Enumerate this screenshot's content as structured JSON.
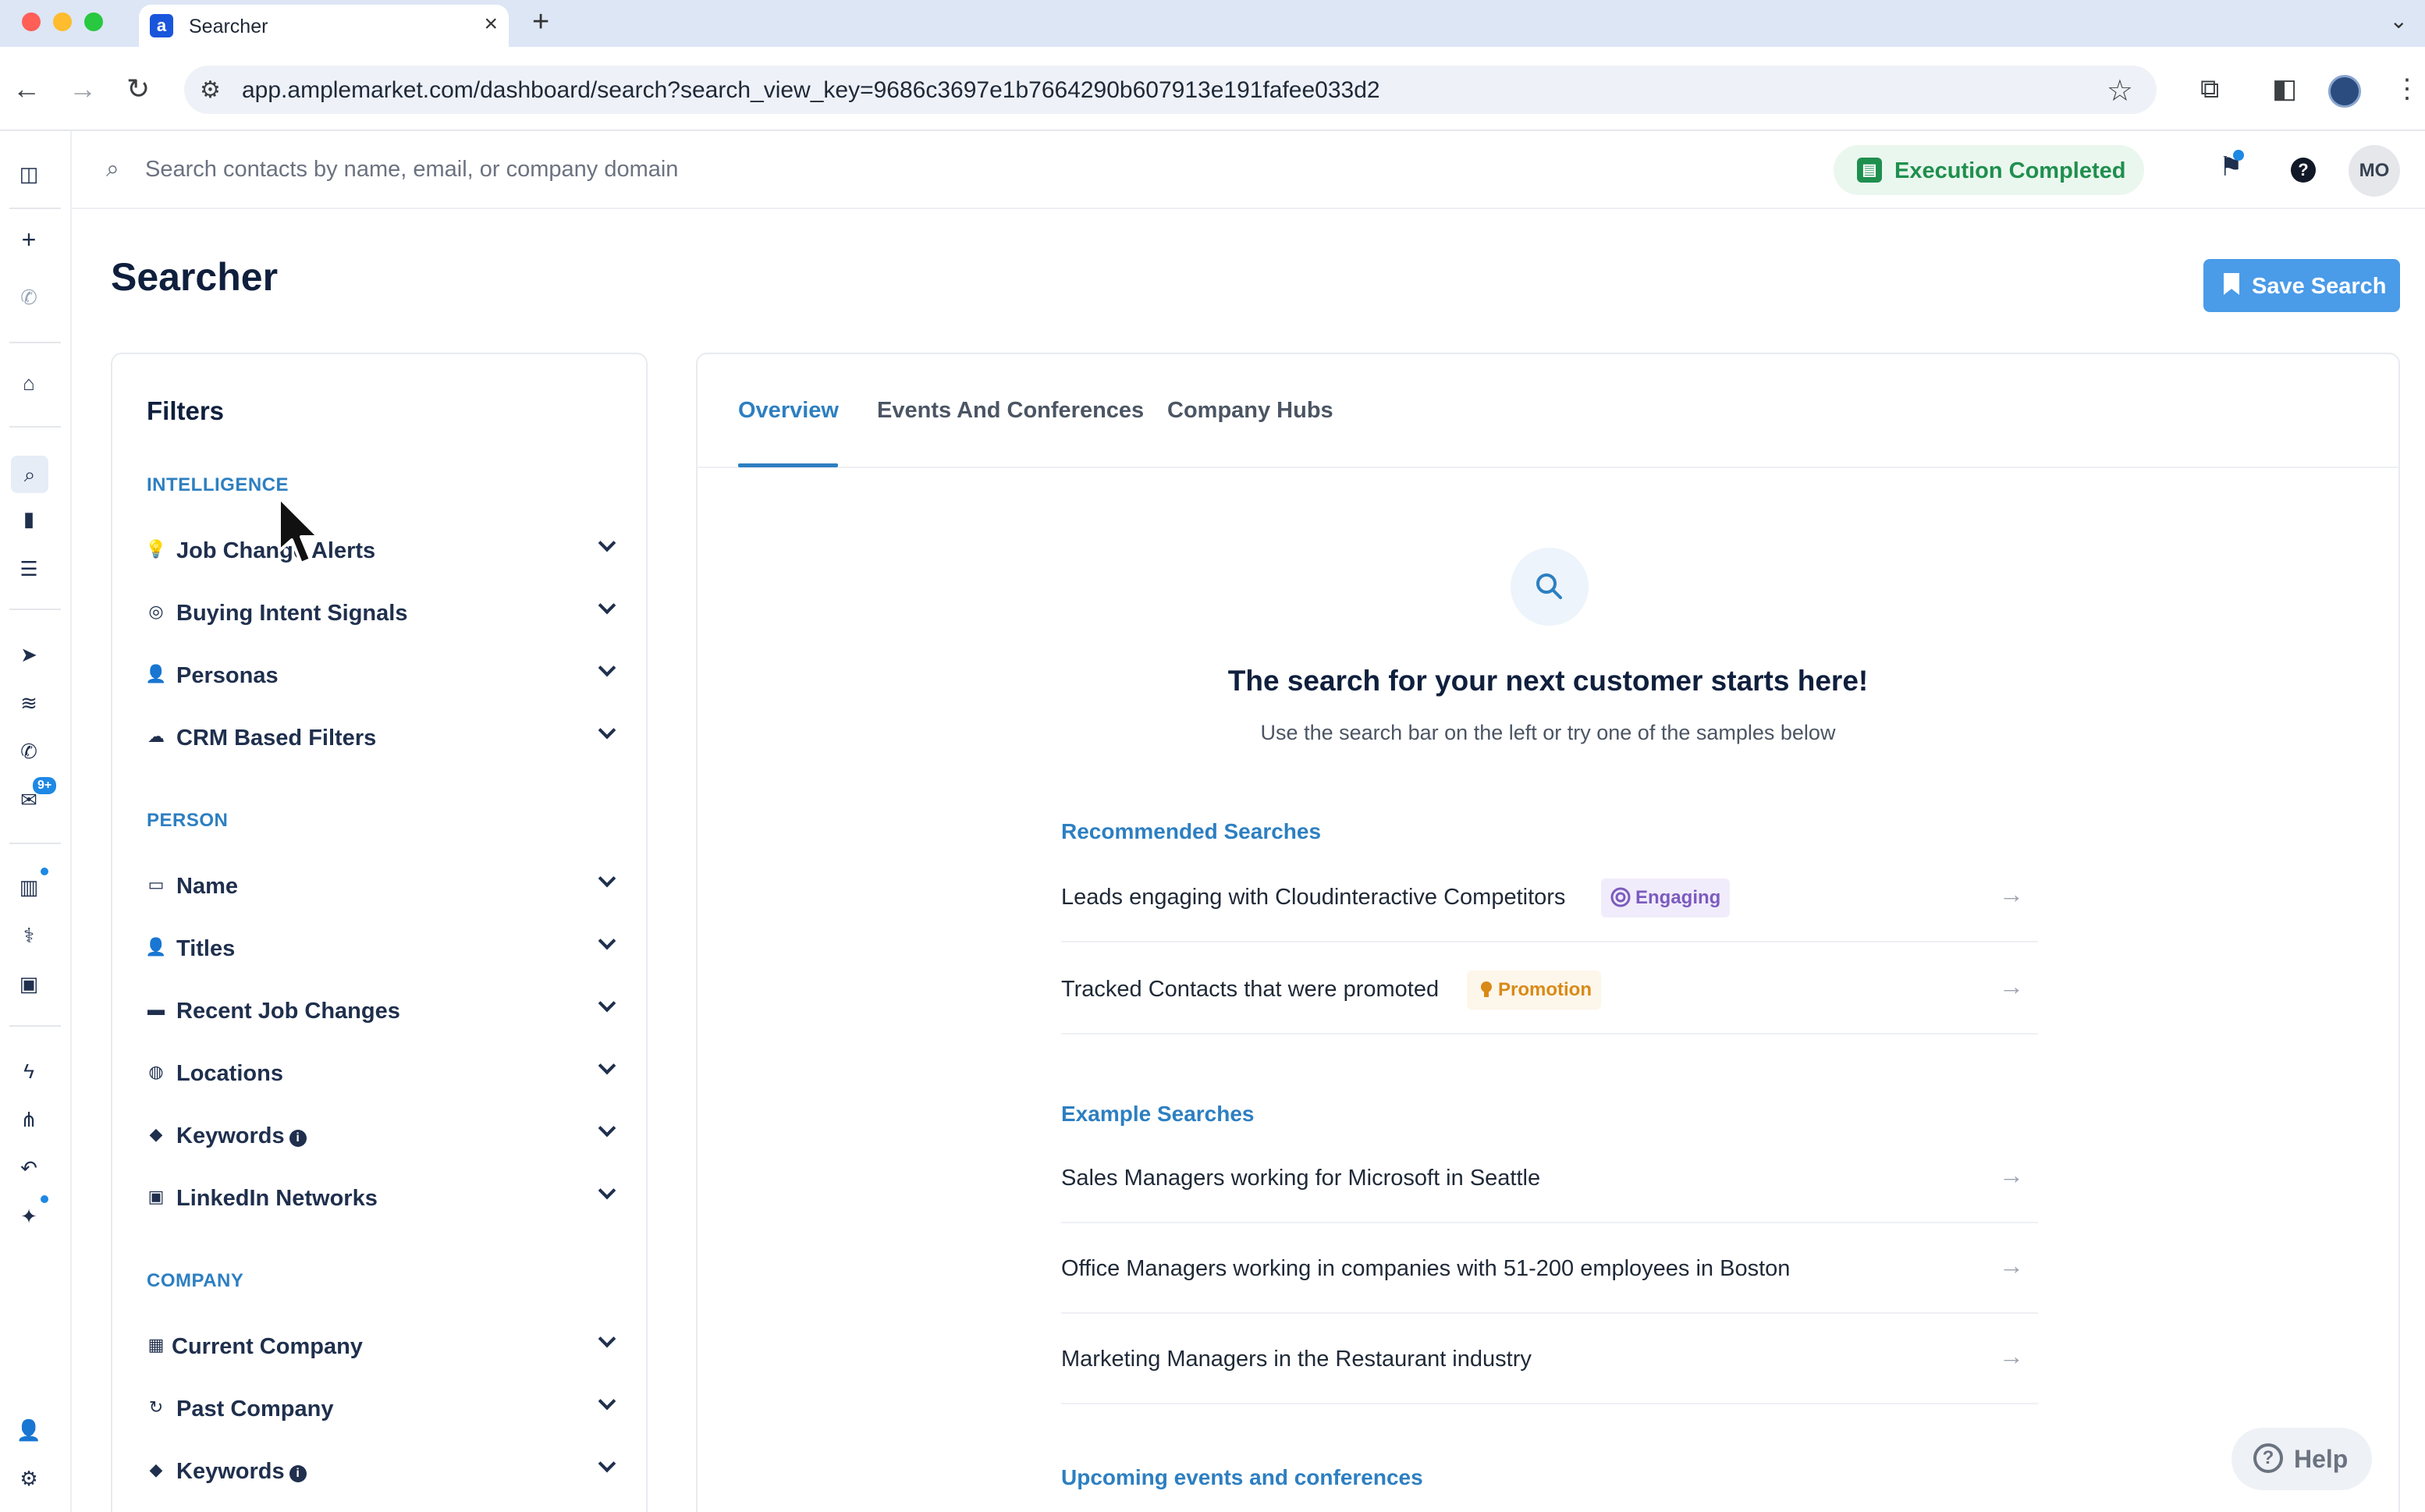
{
  "browser": {
    "tab_title": "Searcher",
    "tab_favicon": "a",
    "url": "app.amplemarket.com/dashboard/search?search_view_key=9686c3697e1b7664290b607913e191fafee033d2"
  },
  "appbar": {
    "search_placeholder": "Search contacts by name, email, or company domain",
    "execution_status": "Execution Completed",
    "avatar_initials": "MO"
  },
  "rail": {
    "badge": "9+"
  },
  "page": {
    "title": "Searcher",
    "save_button": "Save Search"
  },
  "filters": {
    "title": "Filters",
    "sections": [
      {
        "label": "INTELLIGENCE",
        "items": [
          {
            "label": "Job Change Alerts",
            "icon": "lightbulb-icon"
          },
          {
            "label": "Buying Intent Signals",
            "icon": "target-icon"
          },
          {
            "label": "Personas",
            "icon": "person-icon"
          },
          {
            "label": "CRM Based Filters",
            "icon": "cloud-icon"
          }
        ]
      },
      {
        "label": "PERSON",
        "items": [
          {
            "label": "Name",
            "icon": "id-card-icon"
          },
          {
            "label": "Titles",
            "icon": "person-tie-icon"
          },
          {
            "label": "Recent Job Changes",
            "icon": "briefcase-icon"
          },
          {
            "label": "Locations",
            "icon": "globe-icon"
          },
          {
            "label": "Keywords",
            "icon": "tags-icon",
            "info": true
          },
          {
            "label": "LinkedIn Networks",
            "icon": "linkedin-icon"
          }
        ]
      },
      {
        "label": "COMPANY",
        "items": [
          {
            "label": "Current Company",
            "icon": "building-icon"
          },
          {
            "label": "Past Company",
            "icon": "refresh-icon"
          },
          {
            "label": "Keywords",
            "icon": "tags-icon",
            "info": true
          }
        ]
      }
    ]
  },
  "main": {
    "tabs": [
      "Overview",
      "Events And Conferences",
      "Company Hubs"
    ],
    "hero_title": "The search for your next customer starts here!",
    "hero_subtitle": "Use the search bar on the left or try one of the samples below",
    "recommended": {
      "title": "Recommended Searches",
      "items": [
        {
          "text": "Leads engaging with Cloudinteractive Competitors",
          "tag": "Engaging"
        },
        {
          "text": "Tracked Contacts that were promoted",
          "tag": "Promotion"
        }
      ]
    },
    "examples": {
      "title": "Example Searches",
      "items": [
        "Sales Managers working for Microsoft in Seattle",
        "Office Managers working in companies with 51-200 employees in Boston",
        "Marketing Managers in the Restaurant industry"
      ]
    },
    "upcoming_title": "Upcoming events and conferences"
  },
  "help_widget": "Help",
  "colors": {
    "accent": "#2d7fc1",
    "save_button": "#4a9be8",
    "success": "#1f8f4e",
    "engaging": "#7c5bbf",
    "promotion": "#d88a17"
  }
}
